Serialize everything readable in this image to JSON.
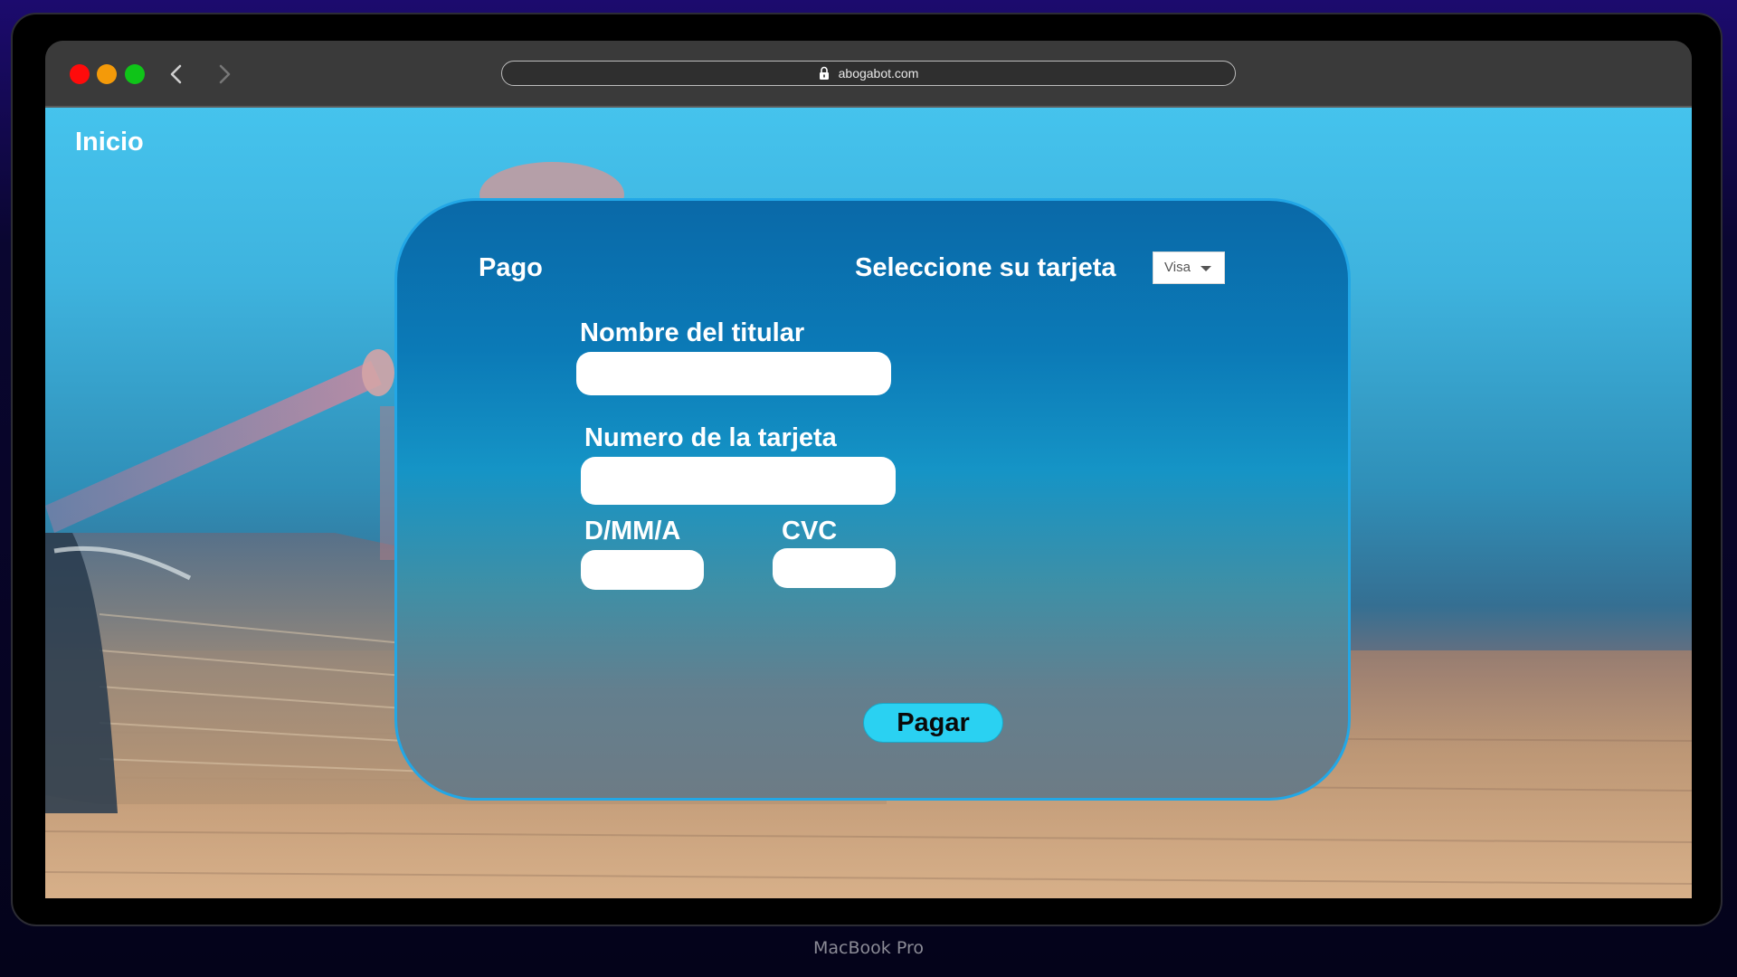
{
  "device": {
    "label": "MacBook Pro"
  },
  "browser": {
    "url": "abogabot.com",
    "icons": [
      "close-dot",
      "minimize-dot",
      "maximize-dot",
      "back-arrow-icon",
      "forward-arrow-icon",
      "lock-icon"
    ]
  },
  "page": {
    "home_link": "Inicio"
  },
  "payment": {
    "title": "Pago",
    "card_select_label": "Seleccione su tarjeta",
    "card_select_value": "Visa",
    "fields": {
      "holder_name_label": "Nombre del titular",
      "holder_name_value": "",
      "card_number_label": "Numero de la tarjeta",
      "card_number_value": "",
      "expiry_label": "D/MM/A",
      "expiry_value": "",
      "cvc_label": "CVC",
      "cvc_value": ""
    },
    "pay_button_label": "Pagar"
  },
  "colors": {
    "panel_border": "#22a7e6",
    "pay_button": "#2ad1f2",
    "traffic_red": "#ff0b0b",
    "traffic_yellow": "#f49a09",
    "traffic_green": "#0fc418"
  }
}
